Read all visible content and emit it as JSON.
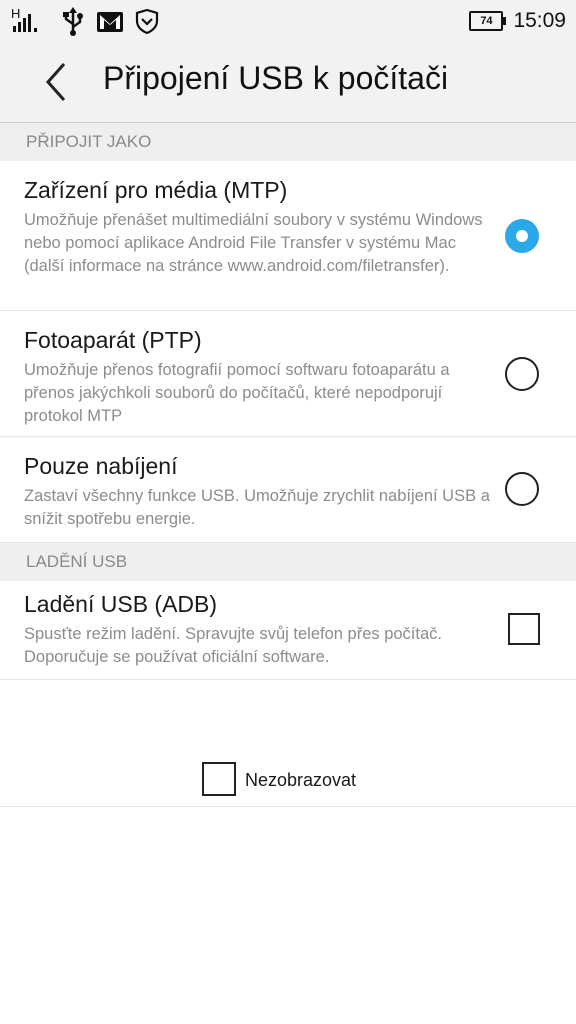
{
  "status_bar": {
    "network_type": "H",
    "icons": [
      "signal-icon",
      "usb-icon",
      "gmail-icon",
      "shield-icon"
    ],
    "battery_level": "74",
    "time": "15:09"
  },
  "header": {
    "back_icon": "chevron-left-icon",
    "title": "Připojení USB k počítači"
  },
  "sections": {
    "connect_as": {
      "header": "PŘIPOJIT JAKO",
      "options": [
        {
          "title": "Zařízení pro média (MTP)",
          "desc": "Umožňuje přenášet multimediální soubory v systému Windows nebo pomocí aplikace Android File Transfer v systému Mac (další informace na stránce www.android.com/filetransfer).",
          "selected": true
        },
        {
          "title": "Fotoaparát (PTP)",
          "desc": "Umožňuje přenos fotografií pomocí softwaru fotoaparátu a přenos jakýchkoli souborů do počítačů, které nepodporují protokol MTP",
          "selected": false
        },
        {
          "title": "Pouze nabíjení",
          "desc": "Zastaví všechny funkce USB. Umožňuje zrychlit nabíjení USB a snížit spotřebu energie.",
          "selected": false
        }
      ]
    },
    "usb_debugging": {
      "header": "LADĚNÍ USB",
      "option": {
        "title": "Ladění USB (ADB)",
        "desc": "Spusťte režim ladění. Spravujte svůj telefon přes počítač. Doporučuje se používat oficiální software.",
        "checked": false
      }
    }
  },
  "footer": {
    "dont_show_label": "Nezobrazovat",
    "checked": false
  },
  "colors": {
    "accent": "#2aa8e8",
    "header_bg": "#f2f2f2",
    "section_bg": "#efefef",
    "secondary_text": "#8c8c8c"
  }
}
